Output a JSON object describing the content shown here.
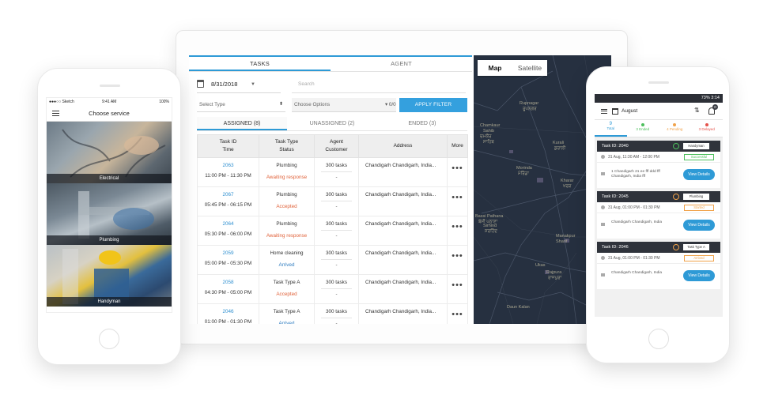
{
  "dashboard": {
    "tabs": [
      {
        "label": "TASKS"
      },
      {
        "label": "AGENT"
      }
    ],
    "date": "8/31/2018",
    "search_placeholder": "Search",
    "select_type": "Select Type",
    "choose_options": "Choose Options",
    "options_count": "0/0",
    "apply_filter": "APPLY FILTER",
    "subtabs": [
      {
        "label": "ASSIGNED (8)"
      },
      {
        "label": "UNASSIGNED (2)"
      },
      {
        "label": "ENDED (3)"
      }
    ],
    "columns": {
      "task_id": "Task ID",
      "time": "Time",
      "task_type": "Task Type",
      "status": "Status",
      "agent": "Agent",
      "customer": "Customer",
      "address": "Address",
      "more": "More"
    },
    "rows": [
      {
        "id": "2063",
        "time": "11:00 PM - 11:30 PM",
        "type": "Plumbing",
        "status": "Awaiting response",
        "status_color": "#e0623a",
        "agent": "300 tasks",
        "customer": "-",
        "address": "Chandigarh Chandigarh, India..."
      },
      {
        "id": "2067",
        "time": "05:45 PM - 06:15 PM",
        "type": "Plumbing",
        "status": "Accepted",
        "status_color": "#e0623a",
        "agent": "300 tasks",
        "customer": "-",
        "address": "Chandigarh Chandigarh, India..."
      },
      {
        "id": "2064",
        "time": "05:30 PM - 06:00 PM",
        "type": "Plumbing",
        "status": "Awaiting response",
        "status_color": "#e0623a",
        "agent": "300 tasks",
        "customer": "-",
        "address": "Chandigarh Chandigarh, India..."
      },
      {
        "id": "2059",
        "time": "05:00 PM - 05:30 PM",
        "type": "Home cleaning",
        "status": "Arrived",
        "status_color": "#2e7cc0",
        "agent": "300 tasks",
        "customer": "-",
        "address": "Chandigarh Chandigarh, India..."
      },
      {
        "id": "2058",
        "time": "04:30 PM - 05:00 PM",
        "type": "Task Type A",
        "status": "Accepted",
        "status_color": "#e0623a",
        "agent": "300 tasks",
        "customer": "-",
        "address": "Chandigarh Chandigarh, India..."
      },
      {
        "id": "2046",
        "time": "01:00 PM - 01:30 PM",
        "type": "Task Type A",
        "status": "Arrived",
        "status_color": "#2e7cc0",
        "agent": "300 tasks",
        "customer": "-",
        "address": "Chandigarh Chandigarh, India..."
      }
    ],
    "more_icon": "ellipsis-icon",
    "map": {
      "toggle": [
        {
          "label": "Map"
        },
        {
          "label": "Satellite"
        }
      ],
      "places": [
        {
          "label": "Rupnagar"
        },
        {
          "label": "ਰੂਪਨਗਰ"
        },
        {
          "label": "Chamkaur"
        },
        {
          "label": "Sahib"
        },
        {
          "label": "ਚਮਕੌਰ"
        },
        {
          "label": "ਸਾਹਿਬ"
        },
        {
          "label": "Kurali"
        },
        {
          "label": "ਕੁਰਾਲੀ"
        },
        {
          "label": "Morinda"
        },
        {
          "label": "ਮੋਰਿੰਡਾ"
        },
        {
          "label": "Kharar"
        },
        {
          "label": "ਖਰੜ"
        },
        {
          "label": "Bassi Pathana"
        },
        {
          "label": "ਬੱਸੀ ਪਠਾਣਾ"
        },
        {
          "label": "Sirhind"
        },
        {
          "label": "ਸਰਹਿੰਦ"
        },
        {
          "label": "Manakpur"
        },
        {
          "label": "Sharif"
        },
        {
          "label": "Ukas"
        },
        {
          "label": "Rajpura"
        },
        {
          "label": "ਰਾਜਪੁਰਾ"
        },
        {
          "label": "Daun Kalan"
        }
      ]
    }
  },
  "phone_left": {
    "status_left": "●●●○○ Sketch",
    "status_time": "9:41 AM",
    "status_right": "100%",
    "title": "Choose service",
    "services": [
      {
        "label": "Electrical"
      },
      {
        "label": "Plumbing"
      },
      {
        "label": "Handyman"
      }
    ]
  },
  "phone_right": {
    "status_right": "73% 3:14",
    "month": "August",
    "badge": "0",
    "counts": [
      {
        "num": "9",
        "label": "Total",
        "color": "#2e9ad6"
      },
      {
        "num": "",
        "label": "3 Ended",
        "color": "#4cbf5c"
      },
      {
        "num": "",
        "label": "4 Pending",
        "color": "#f0a24a"
      },
      {
        "num": "",
        "label": "3 Delayed",
        "color": "#e5534b"
      }
    ],
    "cards": [
      {
        "task": "Task ID: 2040",
        "tag": "Handyman",
        "dot": "#4cbf5c",
        "time": "31 Aug, 11:30 AM - 12:00 PM",
        "pill": "Successful",
        "pill_color": "#4cbf5c",
        "address": "1 Chandigarh 21 ee fff ddd fff Chandigarh, India fff",
        "button": "View Details"
      },
      {
        "task": "Task ID: 2045",
        "tag": "Plumbing",
        "dot": "#f0a24a",
        "time": "31 Aug, 01:00 PM - 01:30 PM",
        "pill": "Started",
        "pill_color": "#f0a24a",
        "address": "Chandigarh Chandigarh, India",
        "button": "View Details"
      },
      {
        "task": "Task ID: 2046",
        "tag": "Task Type A",
        "dot": "#f0a24a",
        "time": "31 Aug, 01:00 PM - 01:30 PM",
        "pill": "Arrived",
        "pill_color": "#f0a24a",
        "address": "Chandigarh Chandigarh, India",
        "button": "View Details"
      }
    ]
  }
}
